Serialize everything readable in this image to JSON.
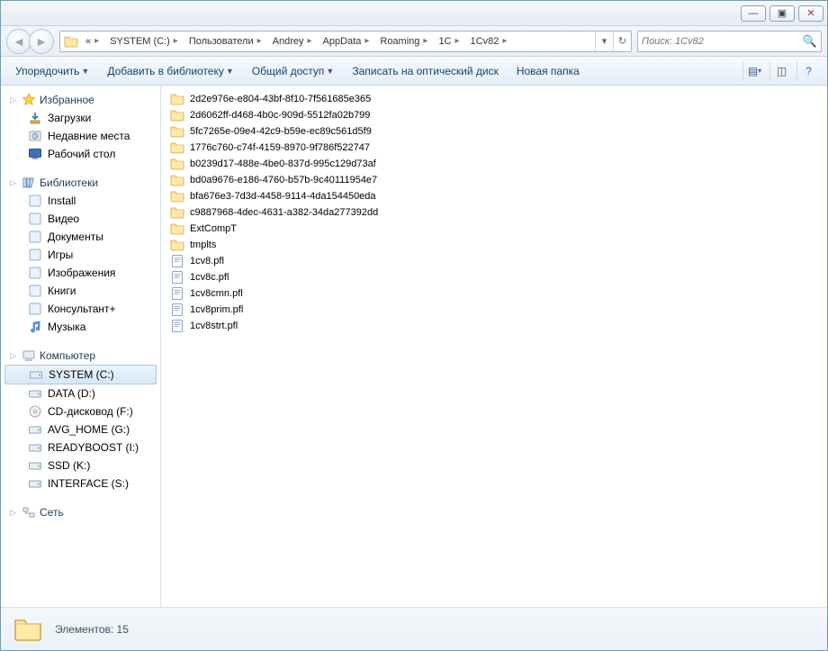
{
  "title_buttons": {
    "min": "—",
    "max": "▣",
    "close": "✕"
  },
  "breadcrumbs": [
    "«",
    "SYSTEM (C:)",
    "Пользователи",
    "Andrey",
    "AppData",
    "Roaming",
    "1C",
    "1Cv82"
  ],
  "search": {
    "placeholder": "Поиск: 1Cv82"
  },
  "toolbar": {
    "organize": "Упорядочить",
    "addlib": "Добавить в библиотеку",
    "share": "Общий доступ",
    "burn": "Записать на оптический диск",
    "newfolder": "Новая папка"
  },
  "sidebar": {
    "favorites": {
      "label": "Избранное",
      "items": [
        "Загрузки",
        "Недавние места",
        "Рабочий стол"
      ]
    },
    "libraries": {
      "label": "Библиотеки",
      "items": [
        "Install",
        "Видео",
        "Документы",
        "Игры",
        "Изображения",
        "Книги",
        "Консультант+",
        "Музыка"
      ]
    },
    "computer": {
      "label": "Компьютер",
      "items": [
        "SYSTEM (C:)",
        "DATA (D:)",
        "CD-дисковод (F:)",
        "AVG_HOME (G:)",
        "READYBOOST (I:)",
        "SSD (K:)",
        "INTERFACE (S:)"
      ],
      "selected": 0
    },
    "network": {
      "label": "Сеть"
    }
  },
  "files": [
    {
      "t": "folder",
      "n": "2d2e976e-e804-43bf-8f10-7f561685e365"
    },
    {
      "t": "folder",
      "n": "2d6062ff-d468-4b0c-909d-5512fa02b799"
    },
    {
      "t": "folder",
      "n": "5fc7265e-09e4-42c9-b59e-ec89c561d5f9"
    },
    {
      "t": "folder",
      "n": "1776c760-c74f-4159-8970-9f786f522747"
    },
    {
      "t": "folder",
      "n": "b0239d17-488e-4be0-837d-995c129d73af"
    },
    {
      "t": "folder",
      "n": "bd0a9676-e186-4760-b57b-9c40111954e7"
    },
    {
      "t": "folder",
      "n": "bfa676e3-7d3d-4458-9114-4da154450eda"
    },
    {
      "t": "folder",
      "n": "c9887968-4dec-4631-a382-34da277392dd"
    },
    {
      "t": "folder",
      "n": "ExtCompT"
    },
    {
      "t": "folder",
      "n": "tmplts"
    },
    {
      "t": "file",
      "n": "1cv8.pfl"
    },
    {
      "t": "file",
      "n": "1cv8c.pfl"
    },
    {
      "t": "file",
      "n": "1cv8cmn.pfl"
    },
    {
      "t": "file",
      "n": "1cv8prim.pfl"
    },
    {
      "t": "file",
      "n": "1cv8strt.pfl"
    }
  ],
  "status": {
    "label": "Элементов: 15"
  }
}
